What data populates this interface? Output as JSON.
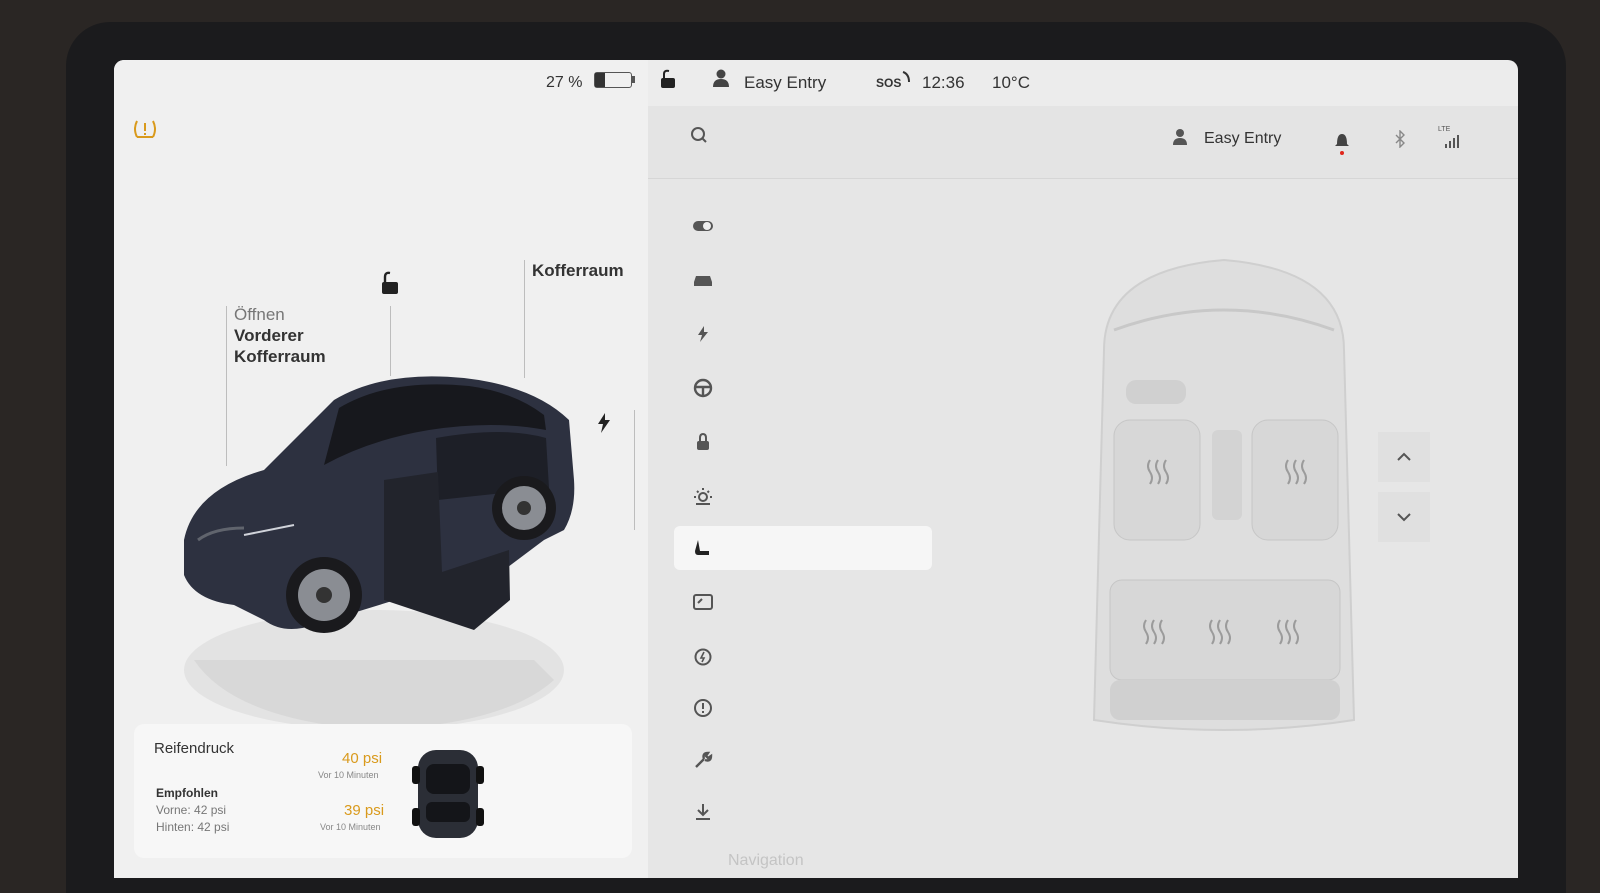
{
  "status_bar": {
    "battery": "27 %",
    "profile": "Easy Entry",
    "sos": "SOS",
    "time": "12:36",
    "temperature": "10°C"
  },
  "header": {
    "profile": "Easy Entry",
    "lte": "LTE"
  },
  "car_view": {
    "frunk_line1": "Öffnen",
    "frunk_line2": "Vorderer",
    "frunk_line3": "Kofferraum",
    "trunk": "Kofferraum"
  },
  "tire_pressure": {
    "title": "Reifendruck",
    "recommended": "Empfohlen",
    "front": "Vorne: 42 psi",
    "rear": "Hinten: 42 psi",
    "front_value": "40 psi",
    "front_time": "Vor 10 Minuten",
    "rear_value": "39 psi",
    "rear_time": "Vor 10 Minuten"
  },
  "sidebar": {
    "items": [
      "toggle-icon",
      "car-icon",
      "bolt-icon",
      "steering-wheel-icon",
      "lock-icon",
      "sun-icon",
      "seat-icon",
      "display-icon",
      "clock-bolt-icon",
      "alert-icon",
      "wrench-icon",
      "download-icon"
    ],
    "active": "seat-icon"
  },
  "bottom": {
    "navigation": "Navigation"
  },
  "colors": {
    "warning": "#d99a1c",
    "accent_red": "#e0261b"
  }
}
